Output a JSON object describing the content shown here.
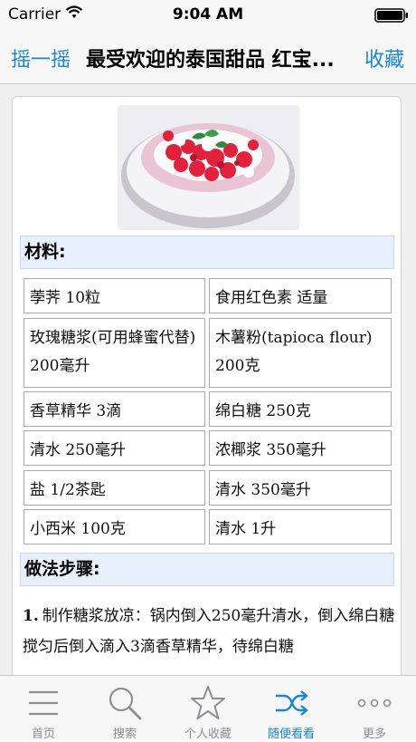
{
  "status_bar": {
    "carrier": "Carrier",
    "time": "9:04 AM"
  },
  "nav": {
    "left": "摇一摇",
    "title": "最受欢迎的泰国甜品 红宝...",
    "right": "收藏"
  },
  "sections": {
    "ingredients": "材料:",
    "steps": "做法步骤:"
  },
  "ingredients": [
    [
      "荸荠 10粒",
      "食用红色素 适量"
    ],
    [
      "玫瑰糖浆(可用蜂蜜代替) 200毫升",
      "木薯粉(tapioca flour) 200克"
    ],
    [
      "香草精华 3滴",
      "绵白糖 250克"
    ],
    [
      "清水 250毫升",
      "浓椰浆 350毫升"
    ],
    [
      "盐 1/2茶匙",
      "清水 350毫升"
    ],
    [
      "小西米 100克",
      "清水 1升"
    ]
  ],
  "step1": {
    "num": "1.",
    "text": "制作糖浆放凉：锅内倒入250毫升清水，倒入绵白糖搅匀后倒入滴入3滴香草精华，待绵白糖"
  },
  "tabs": [
    {
      "label": "首页",
      "icon": "menu-icon"
    },
    {
      "label": "搜索",
      "icon": "search-icon"
    },
    {
      "label": "个人收藏",
      "icon": "star-icon"
    },
    {
      "label": "随便看看",
      "icon": "shuffle-icon"
    },
    {
      "label": "更多",
      "icon": "more-icon"
    }
  ],
  "colors": {
    "accent": "#1a86d3",
    "inactive": "#8e8e93",
    "section_bg": "#e8f0fb"
  }
}
